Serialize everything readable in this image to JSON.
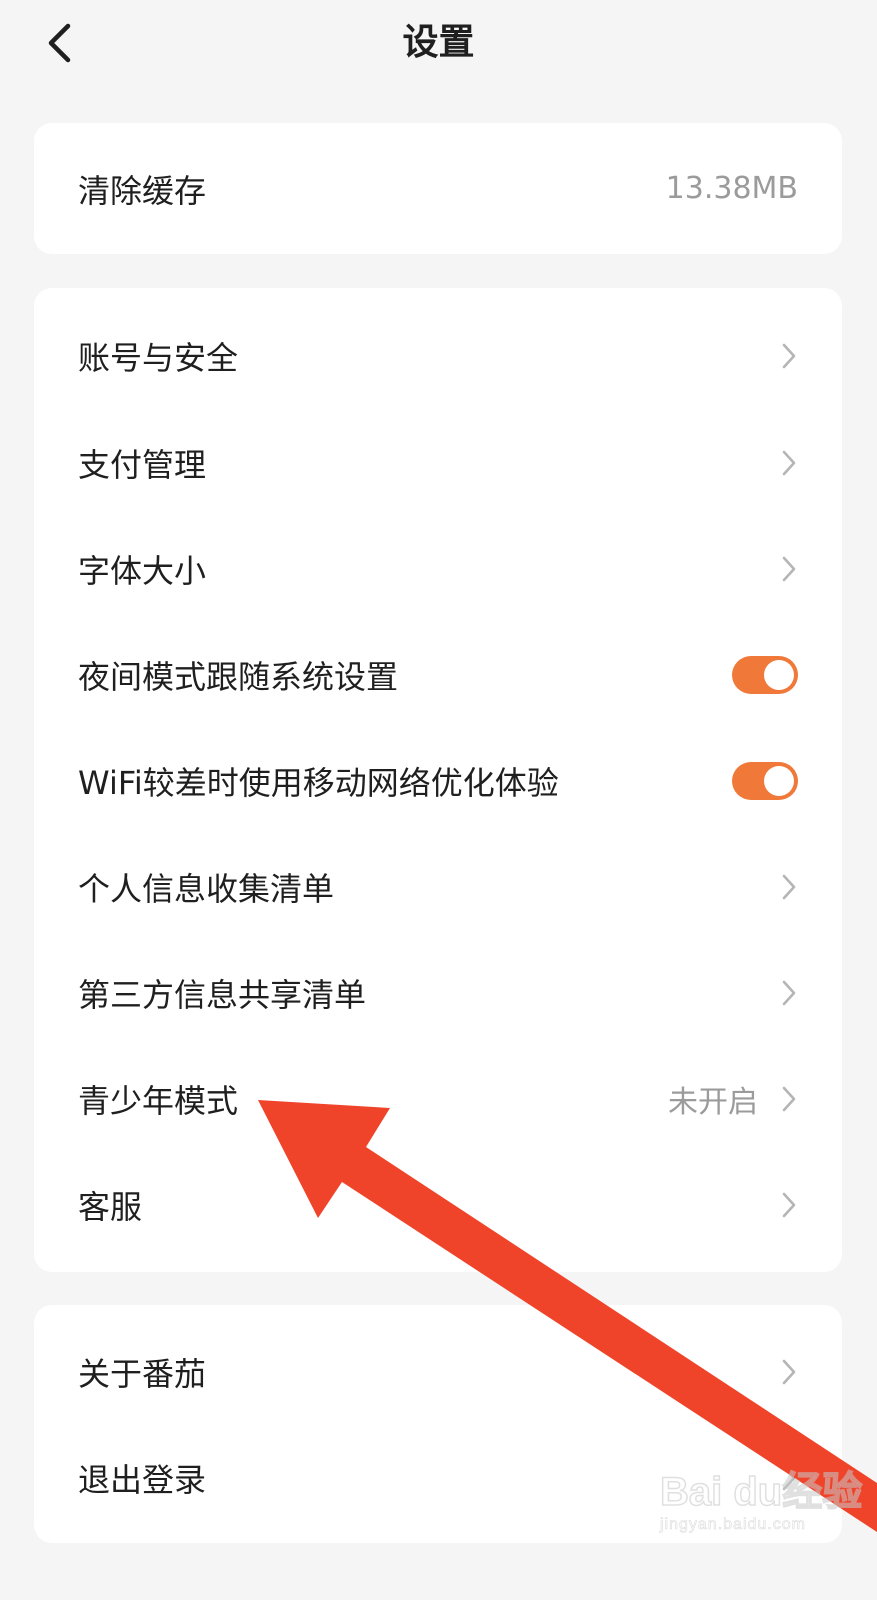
{
  "header": {
    "title": "设置",
    "back_icon": "chevron-left-icon"
  },
  "cache_card": {
    "label": "清除缓存",
    "value": "13.38MB"
  },
  "settings_card": {
    "items": [
      {
        "label": "账号与安全",
        "type": "link"
      },
      {
        "label": "支付管理",
        "type": "link"
      },
      {
        "label": "字体大小",
        "type": "link"
      },
      {
        "label": "夜间模式跟随系统设置",
        "type": "toggle",
        "on": true
      },
      {
        "label": "WiFi较差时使用移动网络优化体验",
        "type": "toggle",
        "on": true
      },
      {
        "label": "个人信息收集清单",
        "type": "link"
      },
      {
        "label": "第三方信息共享清单",
        "type": "link"
      },
      {
        "label": "青少年模式",
        "type": "link",
        "value": "未开启"
      },
      {
        "label": "客服",
        "type": "link"
      }
    ]
  },
  "account_card": {
    "items": [
      {
        "label": "关于番茄",
        "type": "link"
      },
      {
        "label": "退出登录",
        "type": "link"
      }
    ]
  },
  "colors": {
    "toggle_on": "#f07838",
    "annotation_arrow": "#f0442a",
    "background": "#f5f5f5"
  },
  "watermark": {
    "main": "Bai du经验",
    "sub": "jingyan.baidu.com"
  }
}
